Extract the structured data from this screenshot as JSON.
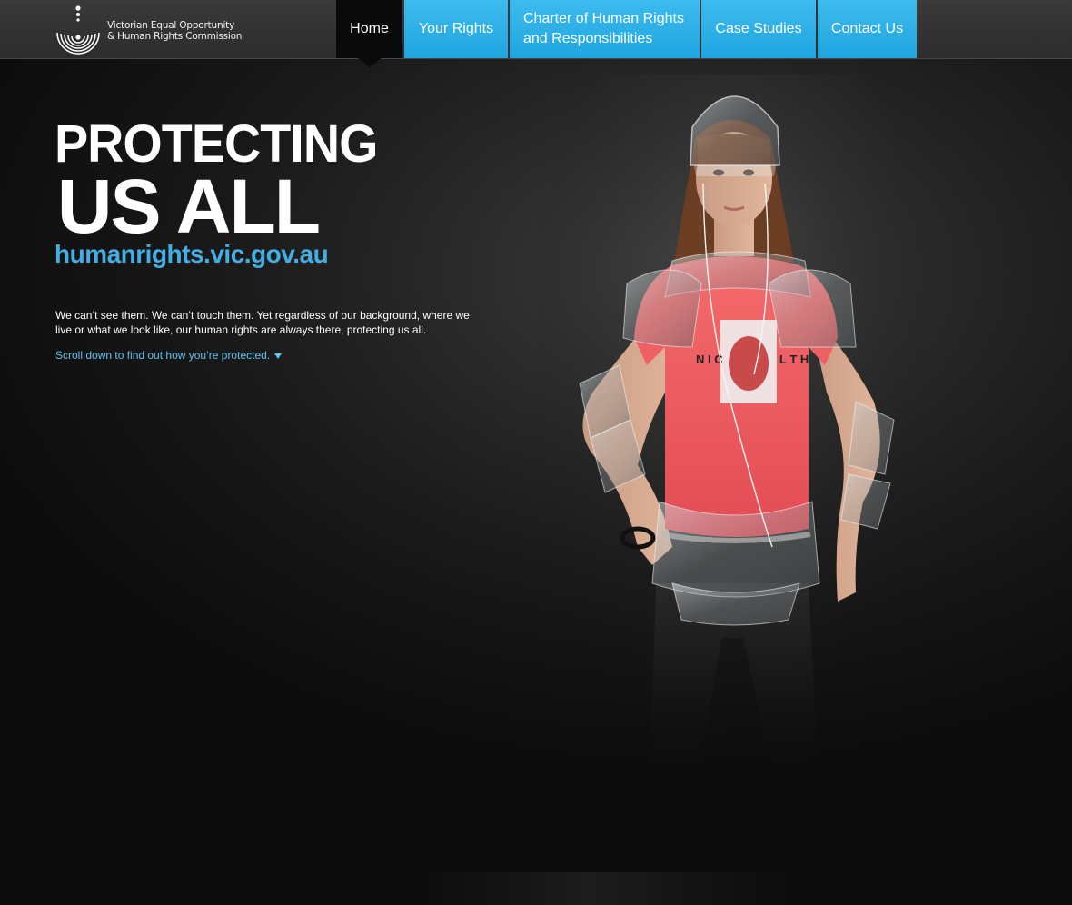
{
  "header": {
    "logo": {
      "line1": "Victorian Equal Opportunity",
      "line2": "& Human Rights Commission"
    },
    "nav": [
      {
        "label": "Home",
        "active": true
      },
      {
        "label": "Your Rights",
        "active": false
      },
      {
        "label": "Charter of Human Rights and Responsibilities",
        "active": false
      },
      {
        "label": "Case Studies",
        "active": false
      },
      {
        "label": "Contact Us",
        "active": false
      }
    ]
  },
  "hero": {
    "headline_line1": "PROTECTING",
    "headline_line2": "US ALL",
    "url": "humanrights.vic.gov.au",
    "intro": "We can’t see them. We can’t touch them. Yet regardless of our background, where we live or what we look like, our human rights are always there, protecting us all.",
    "scroll_link": "Scroll down to find out how you’re protected.",
    "shirt_print": {
      "left": "N I C",
      "right": "L T H"
    }
  },
  "colors": {
    "nav_blue": "#2aafe5",
    "url_blue": "#44aee3",
    "link_blue": "#5ec4f2",
    "background": "#1a1a1a",
    "shirt": "#f25c5c"
  },
  "icons": {
    "logo_mark": "concentric-rings-logo-icon",
    "scroll_arrow": "triangle-down-icon"
  }
}
